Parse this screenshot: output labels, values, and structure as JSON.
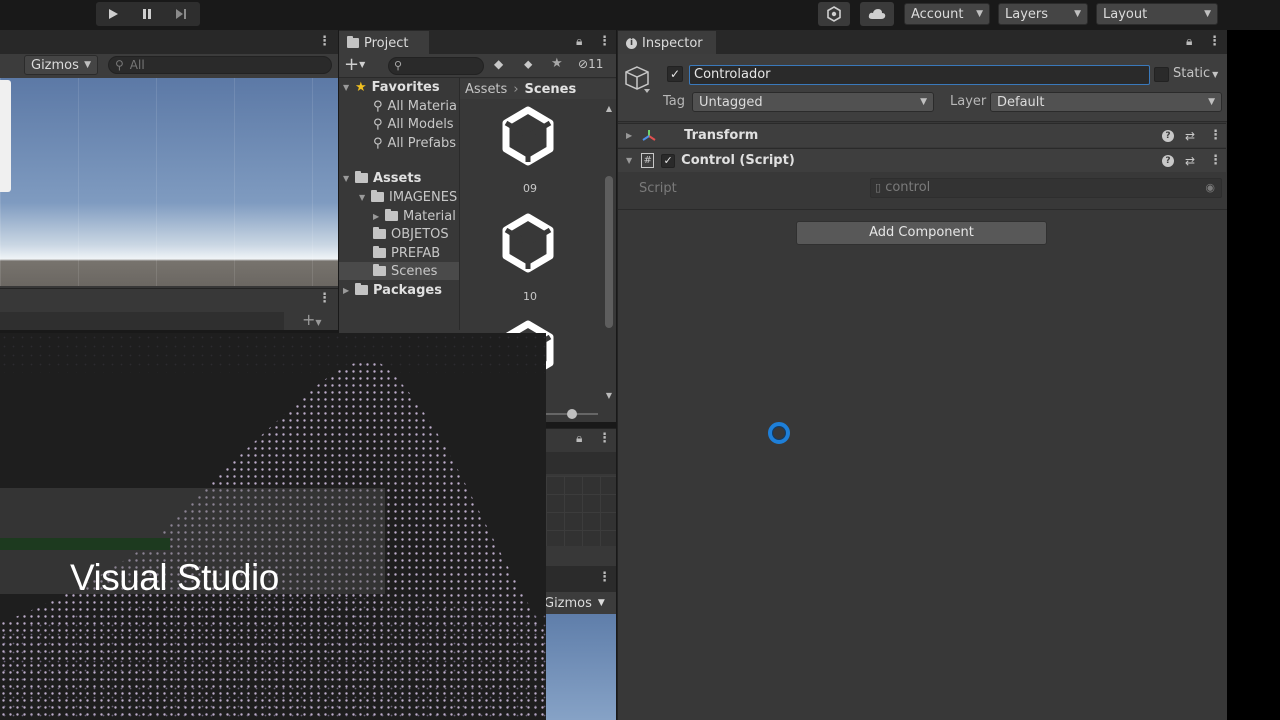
{
  "toolbar": {
    "account_label": "Account",
    "layers_label": "Layers",
    "layout_label": "Layout"
  },
  "scene": {
    "gizmos_label": "Gizmos",
    "search_placeholder": "All"
  },
  "project": {
    "tab_label": "Project",
    "hidden_count": "11",
    "favorites_label": "Favorites",
    "favorites": [
      "All Materia",
      "All Models",
      "All Prefabs"
    ],
    "assets_label": "Assets",
    "folders": [
      "IMAGENES",
      "Material",
      "OBJETOS",
      "PREFAB",
      "Scenes"
    ],
    "packages_label": "Packages",
    "breadcrumb": [
      "Assets",
      "Scenes"
    ],
    "scene_items": [
      "09",
      "10"
    ]
  },
  "game": {
    "gizmos_label": "Gizmos"
  },
  "inspector": {
    "tab_label": "Inspector",
    "object_name": "Controlador",
    "static_label": "Static",
    "tag_label": "Tag",
    "tag_value": "Untagged",
    "layer_label": "Layer",
    "layer_value": "Default",
    "components": [
      "Transform",
      "Control (Script)"
    ],
    "script_field_label": "Script",
    "script_field_value": "control",
    "add_component_label": "Add Component"
  },
  "overlay": {
    "splash_title": "Visual Studio"
  },
  "colors": {
    "panel_bg": "#383838",
    "toolbar_bg": "#191919",
    "tab_bg": "#3c3c3c",
    "field_bg": "#2a2a2a",
    "selection_bg": "#4a4a4a",
    "sky_top": "#5c79a6",
    "ground": "#6b6762",
    "splash_bg": "#1e1e1e",
    "splash_dots": "#d9c6ea",
    "cursor_blue": "#1e7fd8"
  },
  "icons": [
    "play-icon",
    "pause-icon",
    "step-icon",
    "collab-icon",
    "cloud-icon",
    "lock-icon",
    "kebab-icon",
    "star-icon",
    "folder-icon",
    "unity-scene-icon",
    "gameobject-cube-icon",
    "transform-icon",
    "script-icon",
    "help-icon",
    "preset-icon",
    "busy-cursor-icon"
  ]
}
